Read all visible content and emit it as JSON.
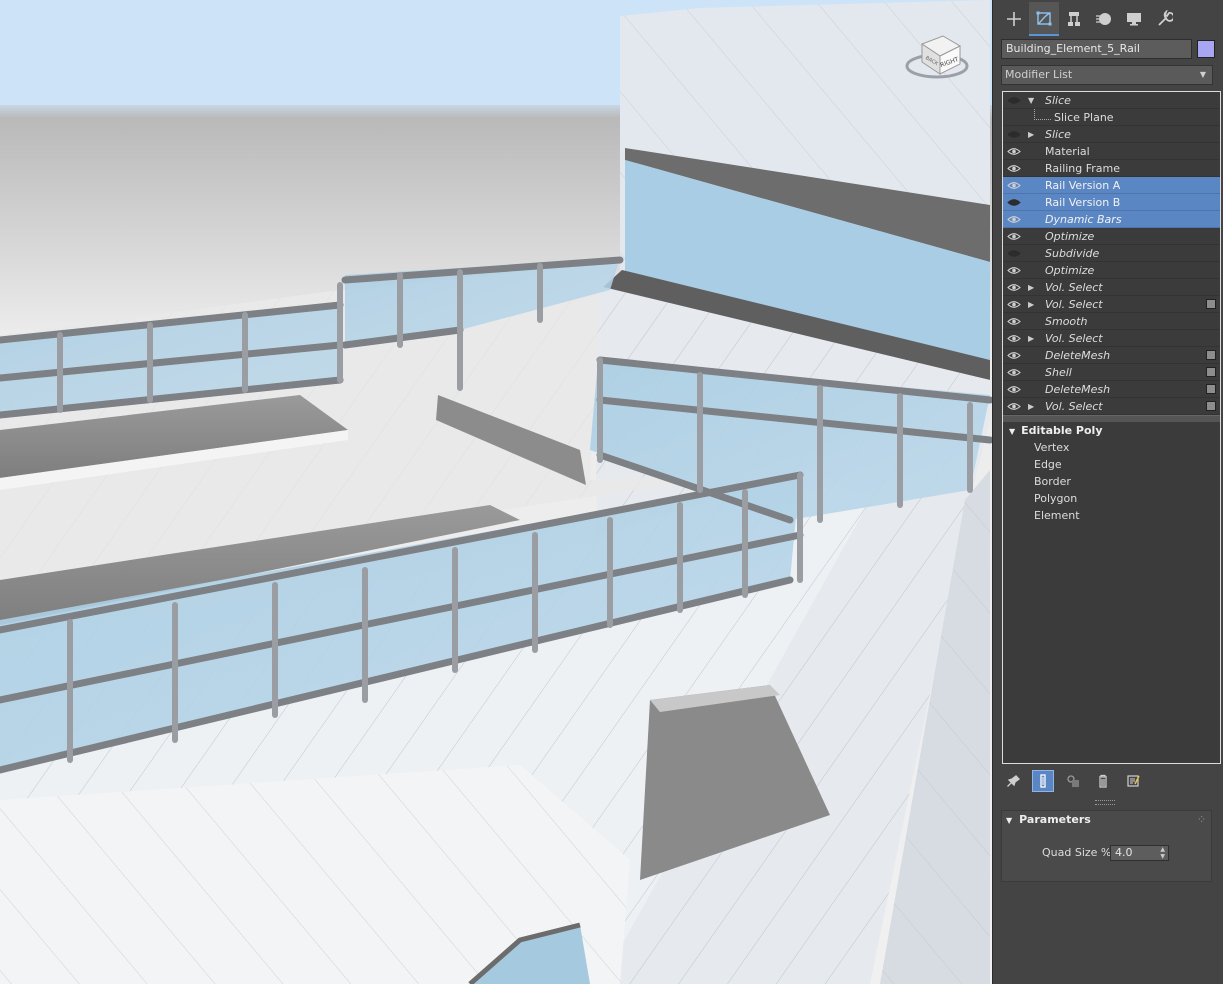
{
  "viewport": {
    "viewcube_label": "RIGHT",
    "viewcube_side_label": "BACK"
  },
  "panel": {
    "tabs": [
      {
        "name": "create-tab",
        "icon": "plus-icon"
      },
      {
        "name": "modify-tab",
        "icon": "modify-icon",
        "active": true
      },
      {
        "name": "hierarchy-tab",
        "icon": "hierarchy-icon"
      },
      {
        "name": "motion-tab",
        "icon": "motion-icon"
      },
      {
        "name": "display-tab",
        "icon": "display-icon"
      },
      {
        "name": "utilities-tab",
        "icon": "wrench-icon"
      }
    ],
    "object_name": "Building_Element_5_Rail",
    "object_color": "#a8a6f0",
    "modifier_list_label": "Modifier List",
    "stack": [
      {
        "label": "Slice",
        "italic": true,
        "expand": "down",
        "eye": "off",
        "selected": false,
        "box": false
      },
      {
        "label": "Slice Plane",
        "sub": true
      },
      {
        "label": "Slice",
        "italic": true,
        "expand": "right",
        "eye": "off",
        "selected": false,
        "box": false
      },
      {
        "label": "Material",
        "italic": false,
        "eye": "on",
        "selected": false,
        "box": false
      },
      {
        "label": "Railing Frame",
        "italic": false,
        "eye": "on",
        "selected": false,
        "box": false
      },
      {
        "label": "Rail Version A",
        "italic": false,
        "eye": "on",
        "selected": true,
        "box": false
      },
      {
        "label": "Rail Version B",
        "italic": false,
        "eye": "off",
        "selected": true,
        "box": false
      },
      {
        "label": "Dynamic Bars",
        "italic": true,
        "eye": "on",
        "selected": true,
        "box": false
      },
      {
        "label": "Optimize",
        "italic": true,
        "eye": "on",
        "selected": false,
        "box": false
      },
      {
        "label": "Subdivide",
        "italic": true,
        "eye": "off",
        "selected": false,
        "box": false
      },
      {
        "label": "Optimize",
        "italic": true,
        "eye": "on",
        "selected": false,
        "box": false
      },
      {
        "label": "Vol. Select",
        "italic": true,
        "expand": "right",
        "eye": "on",
        "selected": false,
        "box": false
      },
      {
        "label": "Vol. Select",
        "italic": true,
        "expand": "right",
        "eye": "on",
        "selected": false,
        "box": true
      },
      {
        "label": "Smooth",
        "italic": true,
        "eye": "on",
        "selected": false,
        "box": false
      },
      {
        "label": "Vol. Select",
        "italic": true,
        "expand": "right",
        "eye": "on",
        "selected": false,
        "box": false
      },
      {
        "label": "DeleteMesh",
        "italic": true,
        "eye": "on",
        "selected": false,
        "box": true
      },
      {
        "label": "Shell",
        "italic": true,
        "eye": "on",
        "selected": false,
        "box": true
      },
      {
        "label": "DeleteMesh",
        "italic": true,
        "eye": "on",
        "selected": false,
        "box": true
      },
      {
        "label": "Vol. Select",
        "italic": true,
        "expand": "right",
        "eye": "on",
        "selected": false,
        "box": true
      }
    ],
    "base_object": {
      "label": "Editable Poly",
      "sub_objects": [
        "Vertex",
        "Edge",
        "Border",
        "Polygon",
        "Element"
      ]
    },
    "stack_tools": [
      {
        "name": "pin-stack-button",
        "icon": "pin-icon"
      },
      {
        "name": "show-end-result-button",
        "icon": "end-result-icon",
        "active": true
      },
      {
        "name": "make-unique-button",
        "icon": "make-unique-icon"
      },
      {
        "name": "remove-modifier-button",
        "icon": "trash-icon"
      },
      {
        "name": "configure-modifier-sets-button",
        "icon": "configure-icon"
      }
    ],
    "parameters": {
      "title": "Parameters",
      "quad_size_label": "Quad Size %:",
      "quad_size_value": "4.0"
    }
  },
  "colors": {
    "selection": "#5b86c4",
    "panel_bg": "#444444",
    "stack_bg": "#3b3b3b"
  }
}
